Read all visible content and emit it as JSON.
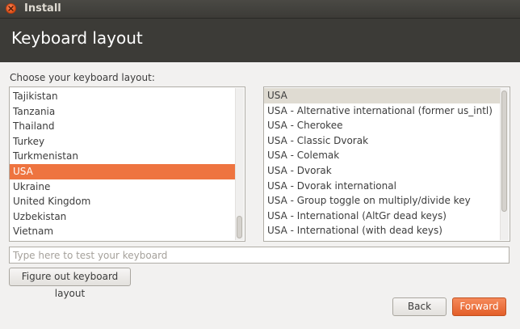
{
  "window": {
    "title": "Install"
  },
  "header": {
    "title": "Keyboard layout"
  },
  "main": {
    "prompt": "Choose your keyboard layout:",
    "countries": [
      "Tajikistan",
      "Tanzania",
      "Thailand",
      "Turkey",
      "Turkmenistan",
      "USA",
      "Ukraine",
      "United Kingdom",
      "Uzbekistan",
      "Vietnam"
    ],
    "selected_country": "USA",
    "variants": [
      "USA",
      "USA - Alternative international (former us_intl)",
      "USA - Cherokee",
      "USA - Classic Dvorak",
      "USA - Colemak",
      "USA - Dvorak",
      "USA - Dvorak international",
      "USA - Group toggle on multiply/divide key",
      "USA - International (AltGr dead keys)",
      "USA - International (with dead keys)"
    ],
    "selected_variant": "USA",
    "test_input": {
      "value": "",
      "placeholder": "Type here to test your keyboard"
    },
    "figure_button": "Figure out keyboard layout"
  },
  "footer": {
    "back_label": "Back",
    "forward_label": "Forward"
  },
  "colors": {
    "accent": "#ee7440",
    "titlebar": "#3c3b37",
    "panel": "#f2f1f0",
    "selection_inactive": "#dfdbd2"
  },
  "icons": {
    "close": "close-icon"
  }
}
